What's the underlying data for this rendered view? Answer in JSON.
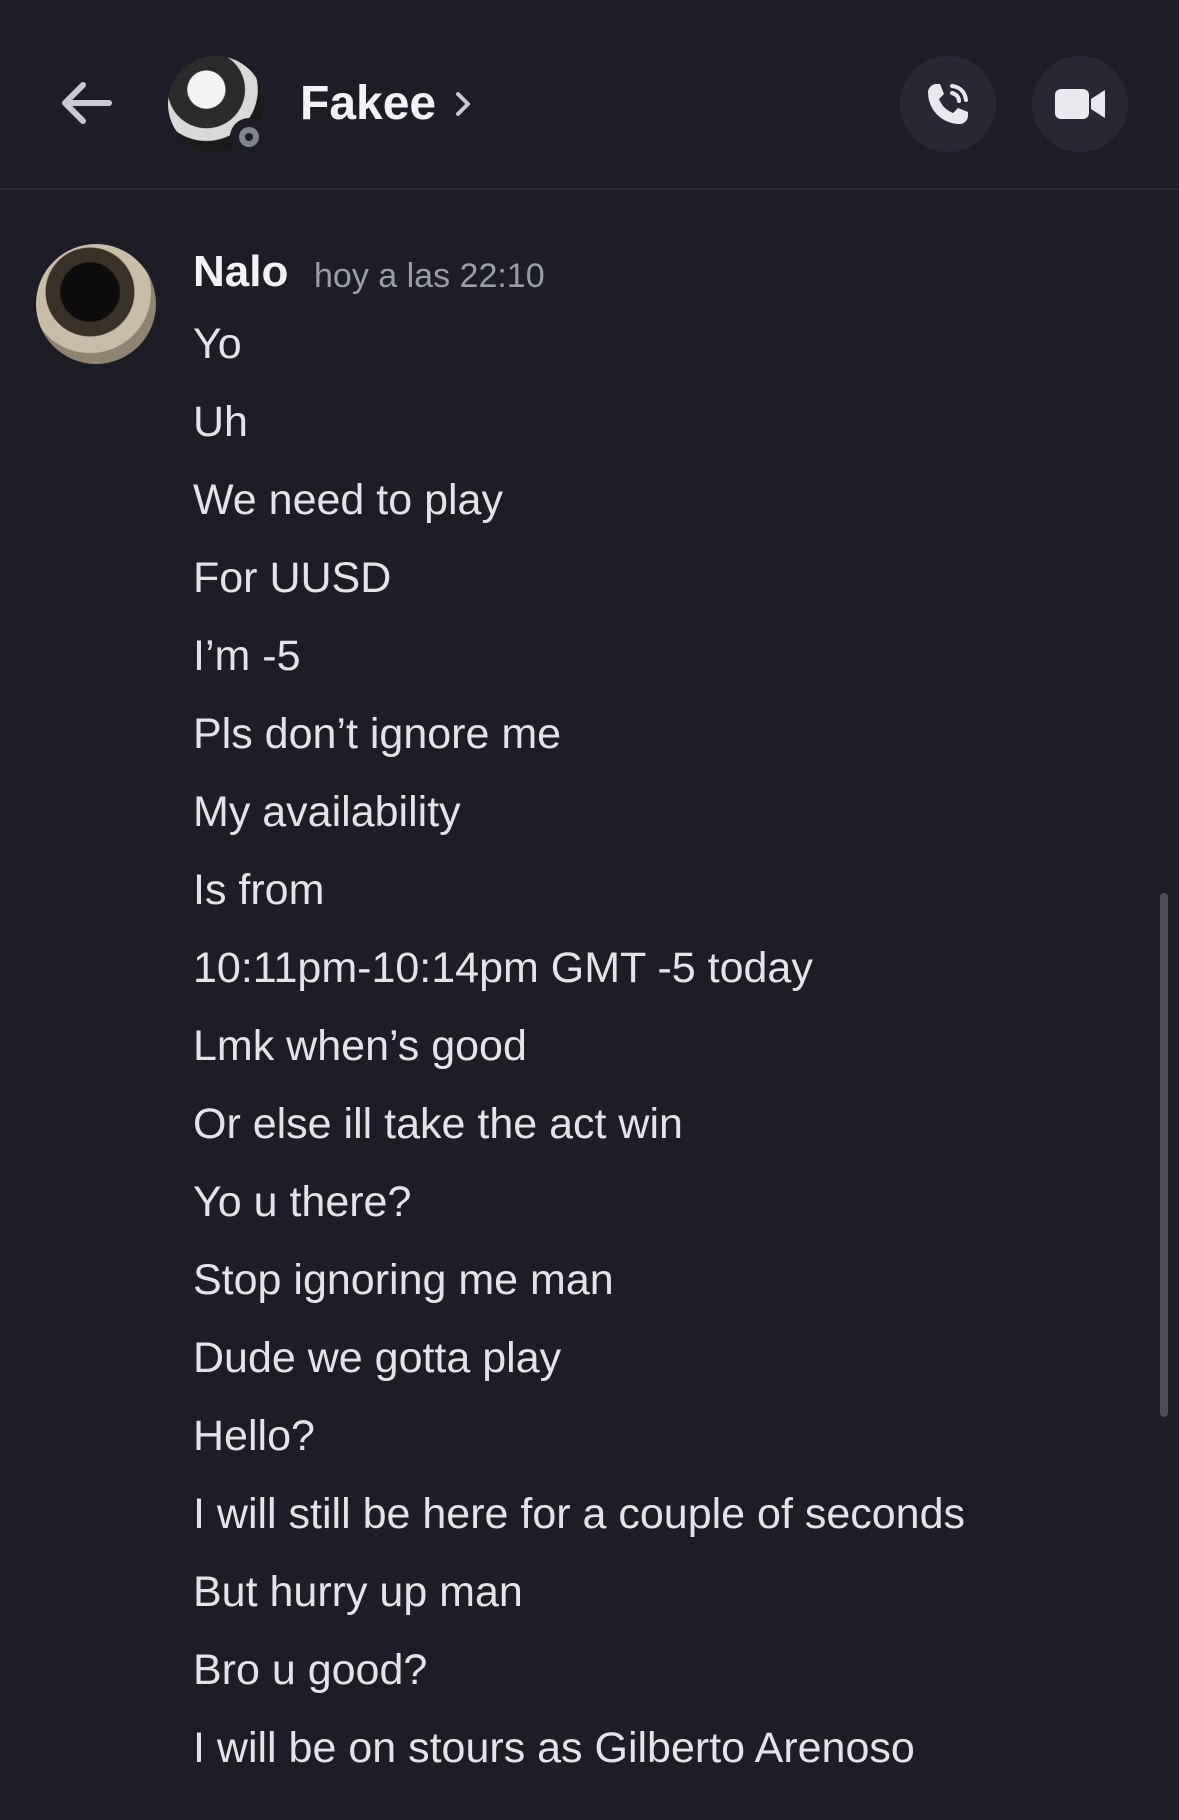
{
  "header": {
    "contact_name": "Fakee",
    "chevron": "›",
    "back_icon": "arrow-left-icon",
    "call_icon": "phone-call-icon",
    "video_icon": "video-camera-icon",
    "status": "offline"
  },
  "message_group": {
    "author": "Nalo",
    "timestamp": "hoy a las 22:10",
    "messages": [
      "Yo",
      "Uh",
      "We need to play",
      "For UUSD",
      "I’m -5",
      "Pls don’t ignore me",
      "My availability",
      "Is from",
      "10:11pm-10:14pm GMT -5 today",
      "Lmk when’s good",
      "Or else ill take the act win",
      "Yo u there?",
      "Stop ignoring me man",
      "Dude we gotta play",
      "Hello?",
      "I will still be here for a couple of seconds",
      "But hurry up man",
      "Bro u good?",
      "I will be on stours as Gilberto Arenoso"
    ]
  },
  "colors": {
    "background": "#1c1d26",
    "button_bg": "#272833",
    "text": "#e3e4e8",
    "muted": "#9a9ca6"
  }
}
